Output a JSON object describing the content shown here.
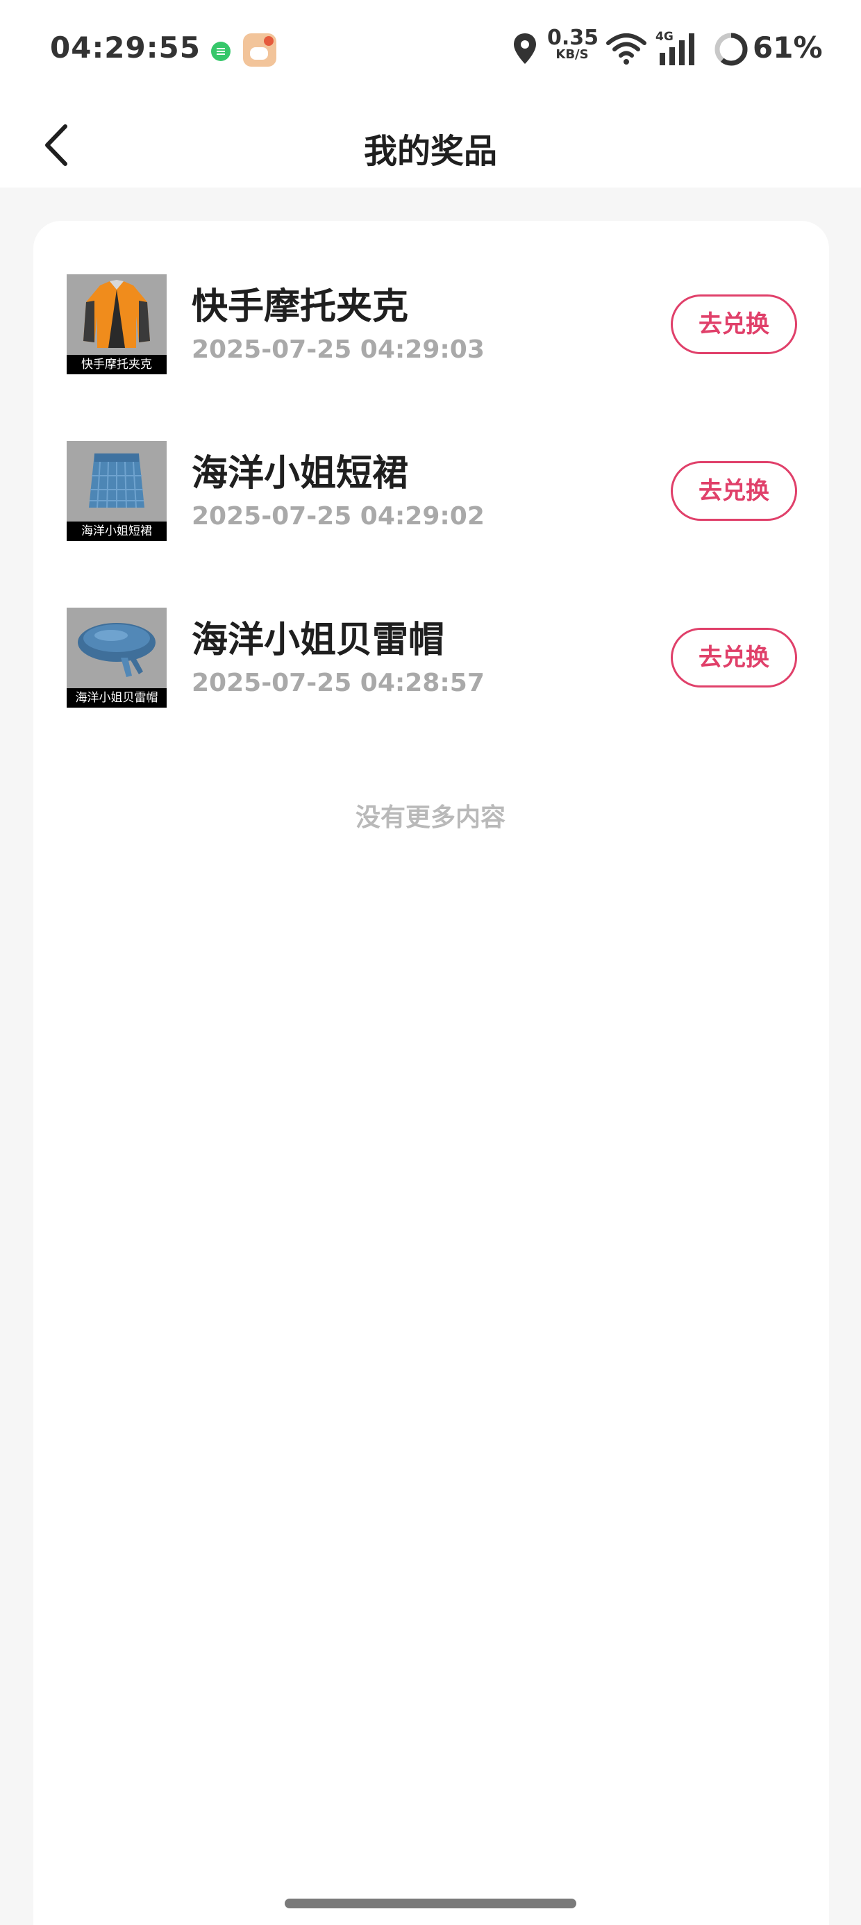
{
  "status_bar": {
    "time": "04:29:55",
    "net_speed_value": "0.35",
    "net_speed_unit": "KB/S",
    "network_type": "4G",
    "battery_percent": "61%",
    "battery_level": 0.61
  },
  "header": {
    "title": "我的奖品",
    "back_icon": "chevron-left-icon"
  },
  "prizes": [
    {
      "name": "快手摩托夹克",
      "time": "2025-07-25 04:29:03",
      "thumb_caption": "快手摩托夹克",
      "button_label": "去兑换"
    },
    {
      "name": "海洋小姐短裙",
      "time": "2025-07-25 04:29:02",
      "thumb_caption": "海洋小姐短裙",
      "button_label": "去兑换"
    },
    {
      "name": "海洋小姐贝雷帽",
      "time": "2025-07-25 04:28:57",
      "thumb_caption": "海洋小姐贝雷帽",
      "button_label": "去兑换"
    }
  ],
  "footer": {
    "no_more_text": "没有更多内容"
  },
  "colors": {
    "accent": "#e0406a",
    "page_background": "#f6f6f6",
    "card_background": "#ffffff",
    "secondary_text": "#a9a9a9"
  }
}
